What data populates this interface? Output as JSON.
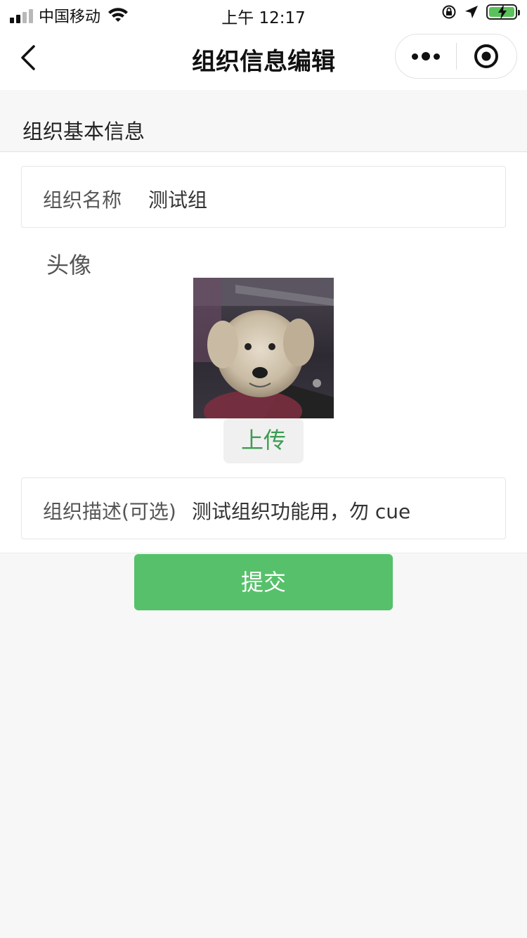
{
  "status_bar": {
    "carrier": "中国移动",
    "time": "上午 12:17"
  },
  "nav": {
    "title": "组织信息编辑"
  },
  "section": {
    "title": "组织基本信息"
  },
  "form": {
    "name_label": "组织名称",
    "name_value": "测试组",
    "avatar_label": "头像",
    "upload_label": "上传",
    "desc_label": "组织描述(可选)",
    "desc_value": "测试组织功能用，勿 cue"
  },
  "submit_label": "提交",
  "colors": {
    "accent": "#56c16a",
    "upload_text": "#3c9c52",
    "page_bg": "#f7f7f7"
  },
  "icons": [
    "signal-icon",
    "wifi-icon",
    "lock-rotation-icon",
    "location-icon",
    "battery-icon",
    "back-icon",
    "more-icon",
    "target-icon"
  ]
}
